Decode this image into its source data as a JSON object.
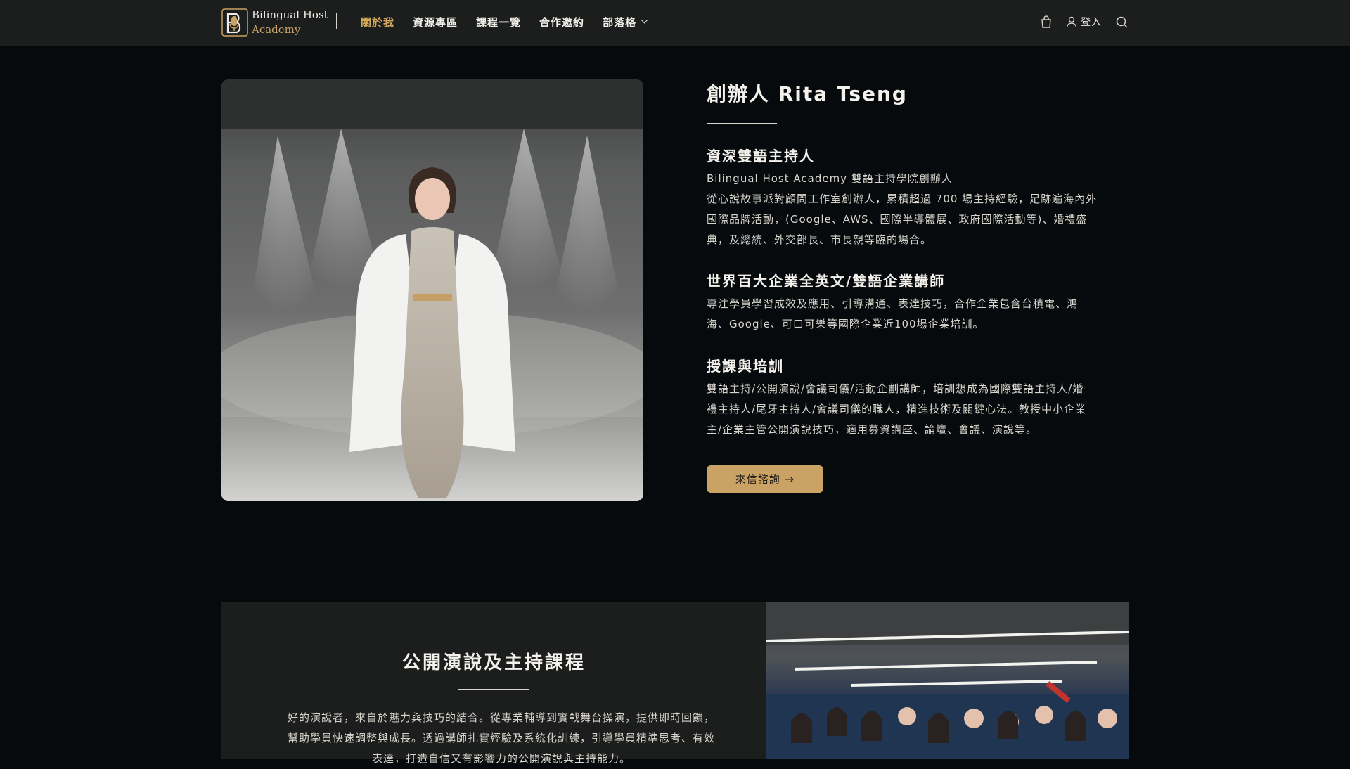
{
  "header": {
    "logo": {
      "line1": "Bilingual Host",
      "line2": "Academy",
      "mark_icon": "microphone-b-logo-icon"
    },
    "nav": [
      {
        "label": "關於我",
        "active": true
      },
      {
        "label": "資源專區",
        "active": false
      },
      {
        "label": "課程一覽",
        "active": false
      },
      {
        "label": "合作邀約",
        "active": false
      },
      {
        "label": "部落格",
        "active": false,
        "dropdown": true
      }
    ],
    "cart_icon": "shopping-bag-icon",
    "user_icon": "user-icon",
    "login_label": "登入",
    "search_icon": "search-icon"
  },
  "hero": {
    "title": "創辦人 Rita Tseng",
    "sections": [
      {
        "heading": "資深雙語主持人",
        "lines": [
          "Bilingual Host Academy 雙語主持學院創辦人",
          "從心說故事派對顧問工作室創辦人，累積超過 700 場主持經驗，足跡遍海內外",
          "國際品牌活動，(Google、AWS、國際半導體展、政府國際活動等)、婚禮盛",
          "典，及總統、外交部長、市長親等臨的場合。"
        ]
      },
      {
        "heading": "世界百大企業全英文/雙語企業講師",
        "lines": [
          "專注學員學習成效及應用、引導溝通、表達技巧，合作企業包含台積電、鴻",
          "海、Google、可口可樂等國際企業近100場企業培訓。"
        ]
      },
      {
        "heading": "授課與培訓",
        "lines": [
          "雙語主持/公開演說/會議司儀/活動企劃講師，培訓想成為國際雙語主持人/婚",
          "禮主持人/尾牙主持人/會議司儀的職人，精進技術及關鍵心法。教授中小企業",
          "主/企業主管公開演說技巧，適用募資講座、論壇、會議、演說等。"
        ]
      }
    ],
    "contact_button": "來信諮詢",
    "contact_arrow": "→"
  },
  "course": {
    "title": "公開演說及主持課程",
    "lines": [
      "好的演說者，來自於魅力與技巧的結合。從專業輔導到實戰舞台操演，提供即時回饋，",
      "幫助學員快速調整與成長。透過講師扎實經驗及系統化訓練，引導學員精準思考、有效",
      "表達，打造自信又有影響力的公開演說與主持能力。"
    ]
  },
  "colors": {
    "accent": "#c9a264",
    "nav_active": "#d4a95b",
    "background": "#060a0d",
    "header": "#1c1e1e"
  }
}
